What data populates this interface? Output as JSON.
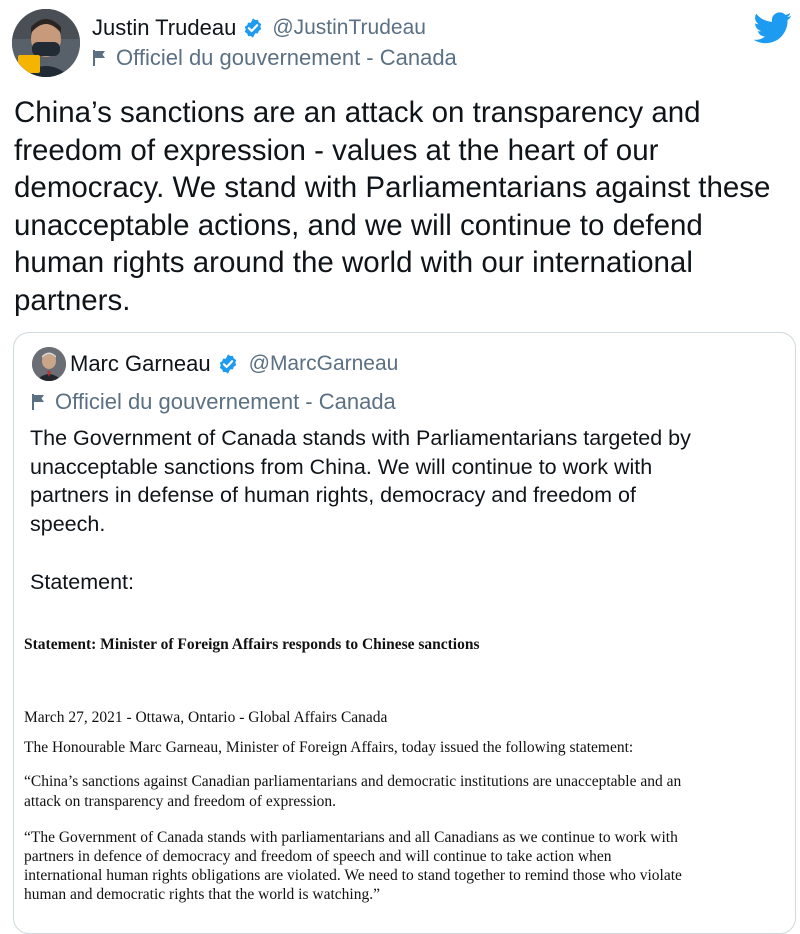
{
  "author": {
    "name": "Justin Trudeau",
    "handle": "@JustinTrudeau",
    "label": "Officiel du gouvernement - Canada"
  },
  "tweet_text": "China’s sanctions are an attack on transparency and\nfreedom of expression - values at the heart of our\ndemocracy. We stand with Parliamentarians against these\nunacceptable actions, and we will continue to defend\nhuman rights around the world with our international\npartners.",
  "quoted": {
    "name": "Marc Garneau",
    "handle": "@MarcGarneau",
    "label": "Officiel du gouvernement - Canada",
    "text": "The Government of Canada stands with Parliamentarians targeted by\nunacceptable sanctions from China. We will continue to work with\npartners in defense of human rights, democracy and freedom of\nspeech.",
    "statement_label": "Statement:",
    "document": {
      "title": "Statement: Minister of Foreign Affairs responds to Chinese sanctions",
      "dateline": "March 27, 2021 - Ottawa, Ontario - Global Affairs Canada",
      "intro": "The Honourable Marc Garneau, Minister of Foreign Affairs, today issued the following statement:",
      "para1": "“China’s sanctions against Canadian parliamentarians and democratic institutions are unacceptable and an\nattack on transparency and freedom of expression.",
      "para2": "“The Government of Canada stands with parliamentarians and all Canadians as we continue to work with\npartners in defence of democracy and freedom of speech and will continue to take action when\ninternational human rights obligations are violated. We need to stand together to remind those who violate\nhuman and democratic rights that the world is watching.”"
    }
  },
  "icons": {
    "verified": "verified-badge-icon",
    "flag": "flag-icon",
    "brand": "twitter-bird-icon"
  },
  "colors": {
    "verified": "#1d9bf0",
    "secondary_text": "#5b7083",
    "border": "#cfd9de"
  }
}
